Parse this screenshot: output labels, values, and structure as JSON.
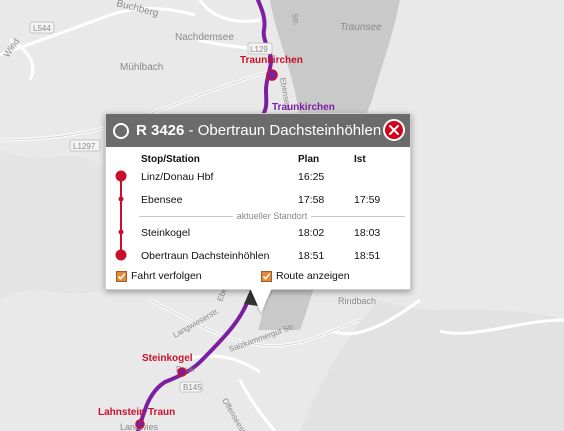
{
  "map": {
    "labels": {
      "buchberg": "Buchberg",
      "nachdemsee": "Nachdemsee",
      "muehlbach": "Mühlbach",
      "traunsee": "Traunsee",
      "rindbach": "Rindbach",
      "road_l544": "L544",
      "road_l1297": "L1297",
      "road_l129": "L129",
      "wind": "Wind",
      "str_top": "Str.",
      "str_mid": "Ebenseer",
      "road_a": "Langwieserstr.",
      "road_b": "Salzkammergut Str.",
      "road_c": "Offenseestr.",
      "road_d": "Ebensee Str.",
      "road_e": "B145",
      "pauk": "Pauk",
      "langwies": "Langwies"
    },
    "stations": {
      "traunkirchen_red": "Traunkirchen",
      "traunkirchen_purple": "Traunkirchen",
      "steinkogel": "Steinkogel",
      "lahnstein": "Lahnstein Traun"
    },
    "colors": {
      "route_purple": "#7a1fa2",
      "station_red": "#c8102e"
    }
  },
  "popup": {
    "train_number": "R 3426",
    "separator": " - ",
    "destination": "Obertraun Dachsteinhöhlen",
    "columns": {
      "stop": "Stop/Station",
      "plan": "Plan",
      "ist": "Ist"
    },
    "stops": [
      {
        "name": "Linz/Donau Hbf",
        "plan": "16:25",
        "ist": ""
      },
      {
        "name": "Ebensee",
        "plan": "17:58",
        "ist": "17:59"
      },
      {
        "name": "Steinkogel",
        "plan": "18:02",
        "ist": "18:03"
      },
      {
        "name": "Obertraun Dachsteinhöhlen",
        "plan": "18:51",
        "ist": "18:51"
      }
    ],
    "current_location": "aktueller Standort",
    "follow_label": "Fahrt verfolgen",
    "route_label": "Route anzeigen",
    "colors": {
      "header": "#6b6b6b",
      "close": "#d0021b",
      "timeline": "#c8102e",
      "checkbox": "#e08a3c"
    }
  }
}
